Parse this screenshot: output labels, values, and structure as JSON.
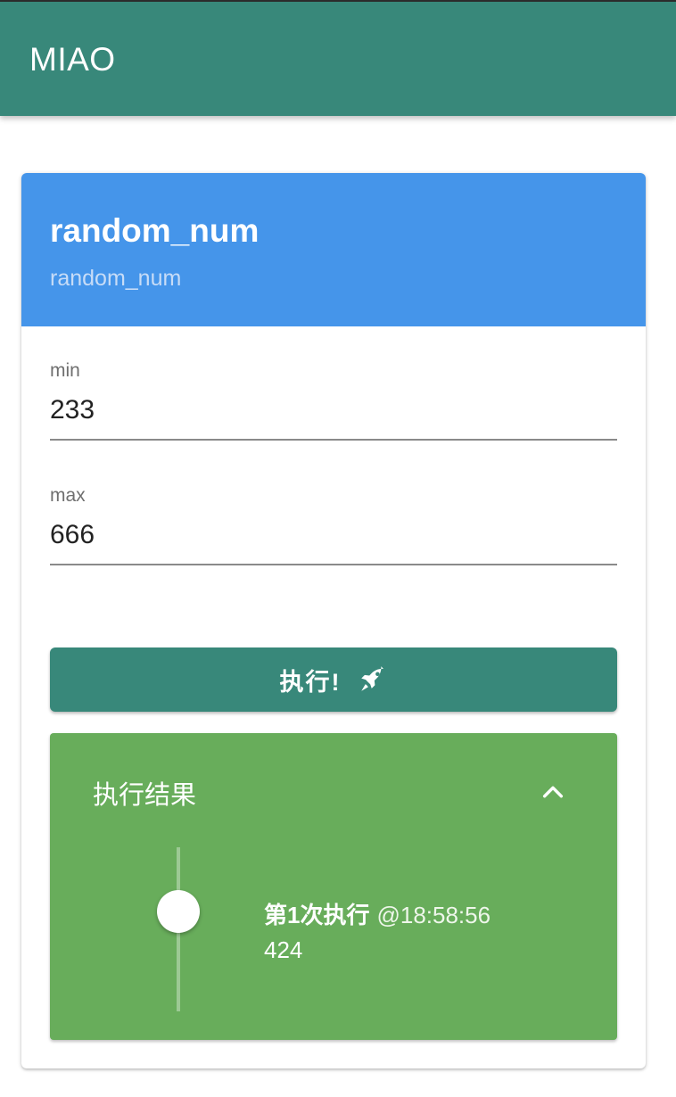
{
  "app": {
    "title": "MIAO"
  },
  "card": {
    "title": "random_num",
    "subtitle": "random_num"
  },
  "fields": {
    "min": {
      "label": "min",
      "value": "233"
    },
    "max": {
      "label": "max",
      "value": "666"
    }
  },
  "run_button": {
    "label": "执行!",
    "icon": "rocket-icon"
  },
  "results": {
    "title": "执行结果",
    "toggle_icon": "chevron-up-icon",
    "entries": [
      {
        "label": "第1次执行",
        "time": "@18:58:56",
        "value": "424"
      }
    ]
  },
  "colors": {
    "appbar": "#38887a",
    "card_header": "#4595ea",
    "button": "#38887a",
    "result_panel": "#68ad5b"
  }
}
